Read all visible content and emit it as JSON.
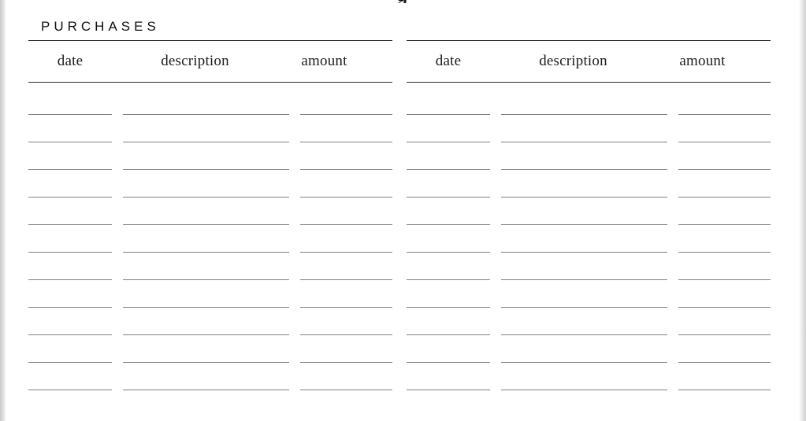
{
  "document": {
    "clipped_heading_fragment": "g",
    "section_title": "PURCHASES"
  },
  "colors": {
    "page_background": "#ffffff",
    "text": "#111111",
    "header_rule": "#2b2b2b",
    "writing_line": "#808080",
    "page_edge": "#d0d0d0"
  },
  "ledgers": [
    {
      "id": "purchases-left",
      "columns": [
        {
          "key": "date",
          "label": "date"
        },
        {
          "key": "description",
          "label": "description"
        },
        {
          "key": "amount",
          "label": "amount"
        }
      ],
      "blank_rows": 11,
      "entries": []
    },
    {
      "id": "purchases-right",
      "columns": [
        {
          "key": "date",
          "label": "date"
        },
        {
          "key": "description",
          "label": "description"
        },
        {
          "key": "amount",
          "label": "amount"
        }
      ],
      "blank_rows": 11,
      "entries": []
    }
  ]
}
